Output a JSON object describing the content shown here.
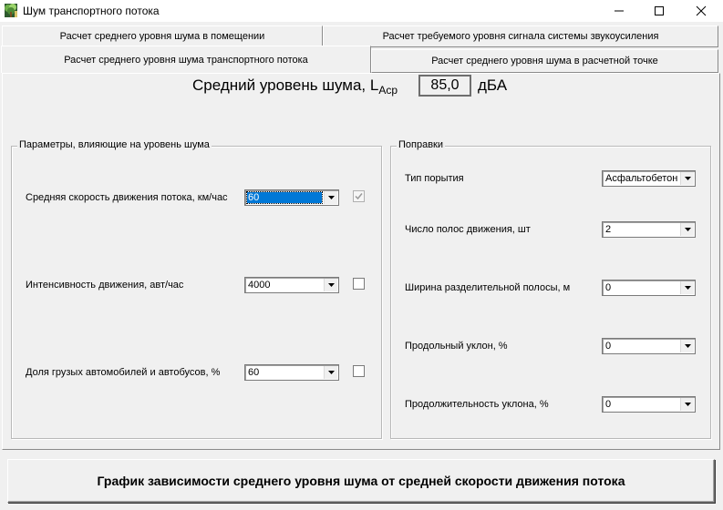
{
  "window": {
    "title": "Шум транспортного потока",
    "icon": "app-tree-icon",
    "controls": {
      "minimize": "minimize-icon",
      "maximize": "maximize-icon",
      "close": "close-icon"
    }
  },
  "tabs": {
    "row1": [
      {
        "label": "Расчет среднего уровня шума в помещении"
      },
      {
        "label": "Расчет требуемого уровня сигнала системы звукоусиления"
      }
    ],
    "row2": [
      {
        "label": "Расчет среднего уровня шума транспортного потока",
        "active": true
      },
      {
        "label": "Расчет среднего уровня шума в расчетной точке"
      }
    ]
  },
  "result": {
    "label": "Средний уровень шума, L",
    "subscript": "Аср",
    "value": "85,0",
    "unit": "дБА"
  },
  "params": {
    "legend": "Параметры, влияющие на уровень шума",
    "rows": [
      {
        "label": "Средняя скорость движения потока, км/час",
        "value": "60",
        "checked": true,
        "disabled": true,
        "focused": true
      },
      {
        "label": "Интенсивность движения, авт/час",
        "value": "4000",
        "checked": false,
        "disabled": false
      },
      {
        "label": "Доля грузых автомобилей и автобусов, %",
        "value": "60",
        "checked": false,
        "disabled": false
      }
    ]
  },
  "corrections": {
    "legend": "Поправки",
    "rows": [
      {
        "label": "Тип порытия",
        "value": "Асфальтобетон"
      },
      {
        "label": "Число полос движения, шт",
        "value": "2"
      },
      {
        "label": "Ширина разделительной полосы, м",
        "value": "0"
      },
      {
        "label": "Продольный уклон, %",
        "value": "0"
      },
      {
        "label": "Продолжительность уклона, %",
        "value": "0"
      }
    ]
  },
  "graph_button": {
    "label": "График зависимости среднего уровня шума от средней скорости движения потока"
  },
  "colors": {
    "face": "#f0f0f0",
    "selection": "#0078d7",
    "border": "#7a7a7a"
  }
}
